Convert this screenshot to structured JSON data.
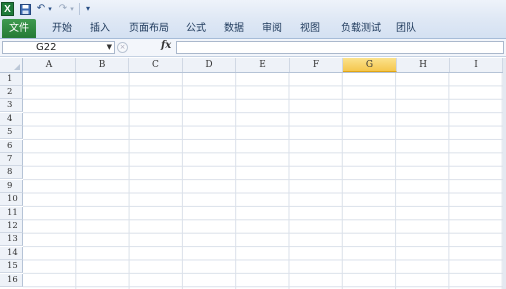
{
  "app_icon": "excel-logo-icon",
  "quick_access": {
    "save_icon": "save-icon",
    "undo_icon": "undo-icon",
    "redo_icon": "redo-icon",
    "customize_icon": "customize-qat-icon"
  },
  "tabs": [
    {
      "label": "文件",
      "active": true
    },
    {
      "label": "开始"
    },
    {
      "label": "插入"
    },
    {
      "label": "页面布局"
    },
    {
      "label": "公式"
    },
    {
      "label": "数据"
    },
    {
      "label": "审阅"
    },
    {
      "label": "视图"
    },
    {
      "label": "负载测试"
    },
    {
      "label": "团队"
    }
  ],
  "formula_bar": {
    "name_box": "G22",
    "fx_label": "fx",
    "formula": ""
  },
  "columns": [
    "A",
    "B",
    "C",
    "D",
    "E",
    "F",
    "G",
    "H",
    "I"
  ],
  "active_column": "G",
  "rows": [
    "1",
    "2",
    "3",
    "4",
    "5",
    "6",
    "7",
    "8",
    "9",
    "10",
    "11",
    "12",
    "13",
    "14",
    "15",
    "16"
  ],
  "colors": {
    "file_tab": "#2e8b40",
    "active_header": "#f5c74e"
  }
}
